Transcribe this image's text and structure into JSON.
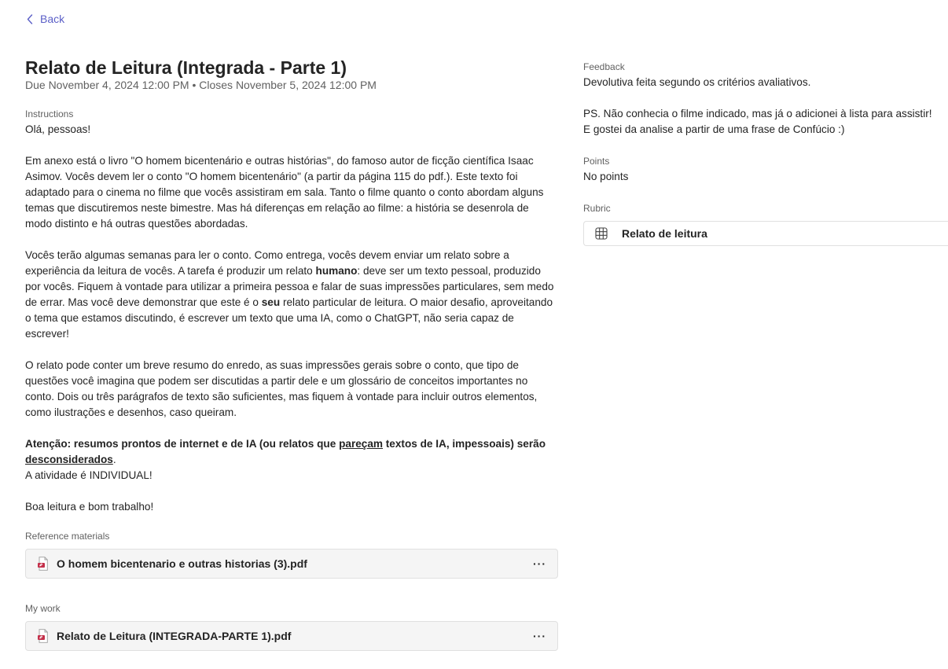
{
  "nav": {
    "back_label": "Back"
  },
  "assignment": {
    "title": "Relato de Leitura (Integrada - Parte 1)",
    "due": "Due November 4, 2024 12:00 PM",
    "separator": "•",
    "closes": "Closes November 5, 2024 12:00 PM"
  },
  "instructions": {
    "label": "Instructions",
    "greeting": "Olá, pessoas!",
    "p1": "Em anexo está o livro \"O homem bicentenário e outras histórias\", do famoso autor de ficção científica Isaac Asimov. Vocês devem ler o conto \"O homem bicentenário\" (a partir da página 115 do pdf.). Este texto foi adaptado para o cinema no filme que vocês assistiram em sala. Tanto o filme quanto o conto abordam alguns temas que discutiremos neste bimestre. Mas há diferenças em relação ao filme: a história se desenrola de modo distinto e há outras questões abordadas.",
    "p2_a": "Vocês terão algumas semanas para ler o conto. Como entrega, vocês devem enviar um relato sobre a experiência da leitura de vocês. A tarefa é produzir um relato ",
    "p2_b": "humano",
    "p2_c": ": deve ser um texto pessoal, produzido por vocês. Fiquem à vontade para utilizar a primeira pessoa e falar de suas impressões particulares, sem medo de errar. Mas você deve demonstrar que este é o ",
    "p2_d": "seu",
    "p2_e": " relato particular de leitura. O maior desafio, aproveitando o tema que estamos discutindo, é escrever um texto que uma IA, como o ChatGPT, não seria capaz de escrever!",
    "p3": "O relato pode conter um breve resumo do enredo, as suas impressões gerais sobre o conto, que tipo de questões você imagina que podem ser discutidas a partir dele e um glossário de conceitos importantes no conto. Dois ou três parágrafos de texto são suficientes, mas fiquem à vontade para incluir outros elementos, como ilustrações e desenhos, caso queiram.",
    "p4_a": "Atenção: resumos prontos de internet e de IA (ou relatos que ",
    "p4_b": "pareçam",
    "p4_c": " textos de IA, impessoais) serão ",
    "p4_d": "desconsiderados",
    "p4_e": ".",
    "p4_line2": "A atividade é INDIVIDUAL!",
    "closing": "Boa leitura e bom trabalho!"
  },
  "reference_materials": {
    "label": "Reference materials",
    "file_name": "O homem bicentenario e outras historias (3).pdf",
    "more_label": "···",
    "file_icon": "pdf-file-icon"
  },
  "my_work": {
    "label": "My work",
    "file_name": "Relato de Leitura (INTEGRADA-PARTE 1).pdf",
    "more_label": "···",
    "file_icon": "pdf-file-icon"
  },
  "feedback": {
    "label": "Feedback",
    "line1": "Devolutiva feita segundo os critérios avaliativos.",
    "line2": "PS. Não conhecia o filme indicado, mas já o adicionei à lista para assistir!",
    "line3": "E gostei da analise a partir de uma frase de Confúcio :)"
  },
  "points": {
    "label": "Points",
    "value": "No points"
  },
  "rubric": {
    "label": "Rubric",
    "name": "Relato de leitura",
    "icon": "table-grid-icon"
  },
  "colors": {
    "accent": "#5b5fc7",
    "pdf_red": "#c4314b",
    "muted_text": "#616161"
  }
}
